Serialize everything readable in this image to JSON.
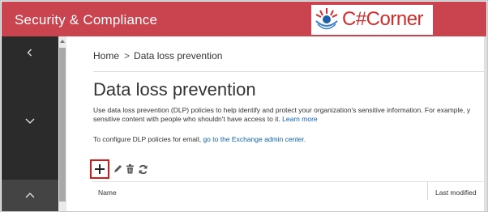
{
  "header": {
    "app_title": "Security & Compliance",
    "brand_color": "#c9444f"
  },
  "watermark": {
    "logo_text": "C#Corner"
  },
  "nav": {
    "collapse_icon": "chevron-left-icon",
    "items": [
      {
        "icon": "chevron-down-icon"
      },
      {
        "icon": "chevron-up-icon"
      }
    ]
  },
  "breadcrumb": {
    "home": "Home",
    "separator": ">",
    "current": "Data loss prevention"
  },
  "page": {
    "title": "Data loss prevention",
    "description_line1": "Use data loss prevention (DLP) policies to help identify and protect your organization's sensitive information. For example, y",
    "description_line2_text": "sensitive content with people who shouldn't have access to it.",
    "learn_more": "Learn more",
    "config_text": "To configure DLP policies for email,",
    "config_link": "go to the Exchange admin center."
  },
  "toolbar": {
    "add_icon": "plus-icon",
    "edit_icon": "pencil-icon",
    "delete_icon": "trash-icon",
    "refresh_icon": "refresh-icon",
    "highlight_color": "#d11c1c"
  },
  "table": {
    "columns": [
      "Name",
      "Last modified"
    ]
  },
  "colors": {
    "nav_bg": "#2b2b2b",
    "link": "#0e62b0"
  }
}
